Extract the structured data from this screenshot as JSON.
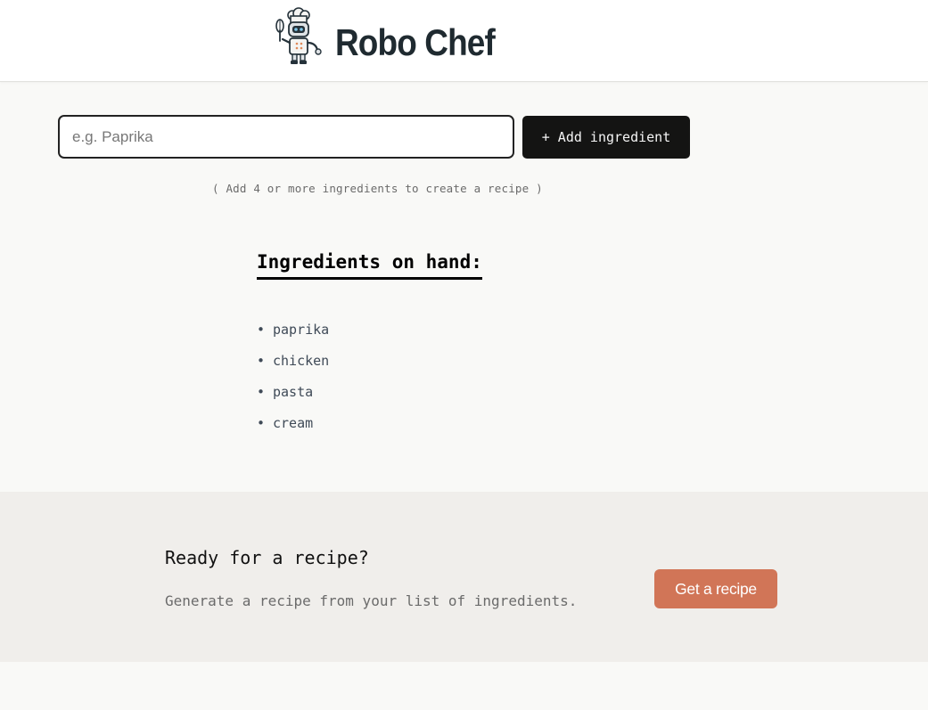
{
  "header": {
    "logo_icon": "robot-chef-icon",
    "title": "Robo Chef"
  },
  "form": {
    "input_placeholder": "e.g. Paprika",
    "input_value": "",
    "add_button_label": "+ Add ingredient",
    "hint": "( Add 4 or more ingredients to create a recipe )"
  },
  "ingredients": {
    "heading": "Ingredients on hand:",
    "items": [
      "paprika",
      "chicken",
      "pasta",
      "cream"
    ]
  },
  "cta": {
    "title": "Ready for a recipe?",
    "description": "Generate a recipe from your list of ingredients.",
    "button_label": "Get a recipe"
  },
  "colors": {
    "accent": "#d17557",
    "dark_button": "#141413",
    "cta_background": "#f0eeeb",
    "page_background": "#f9f9f7"
  }
}
